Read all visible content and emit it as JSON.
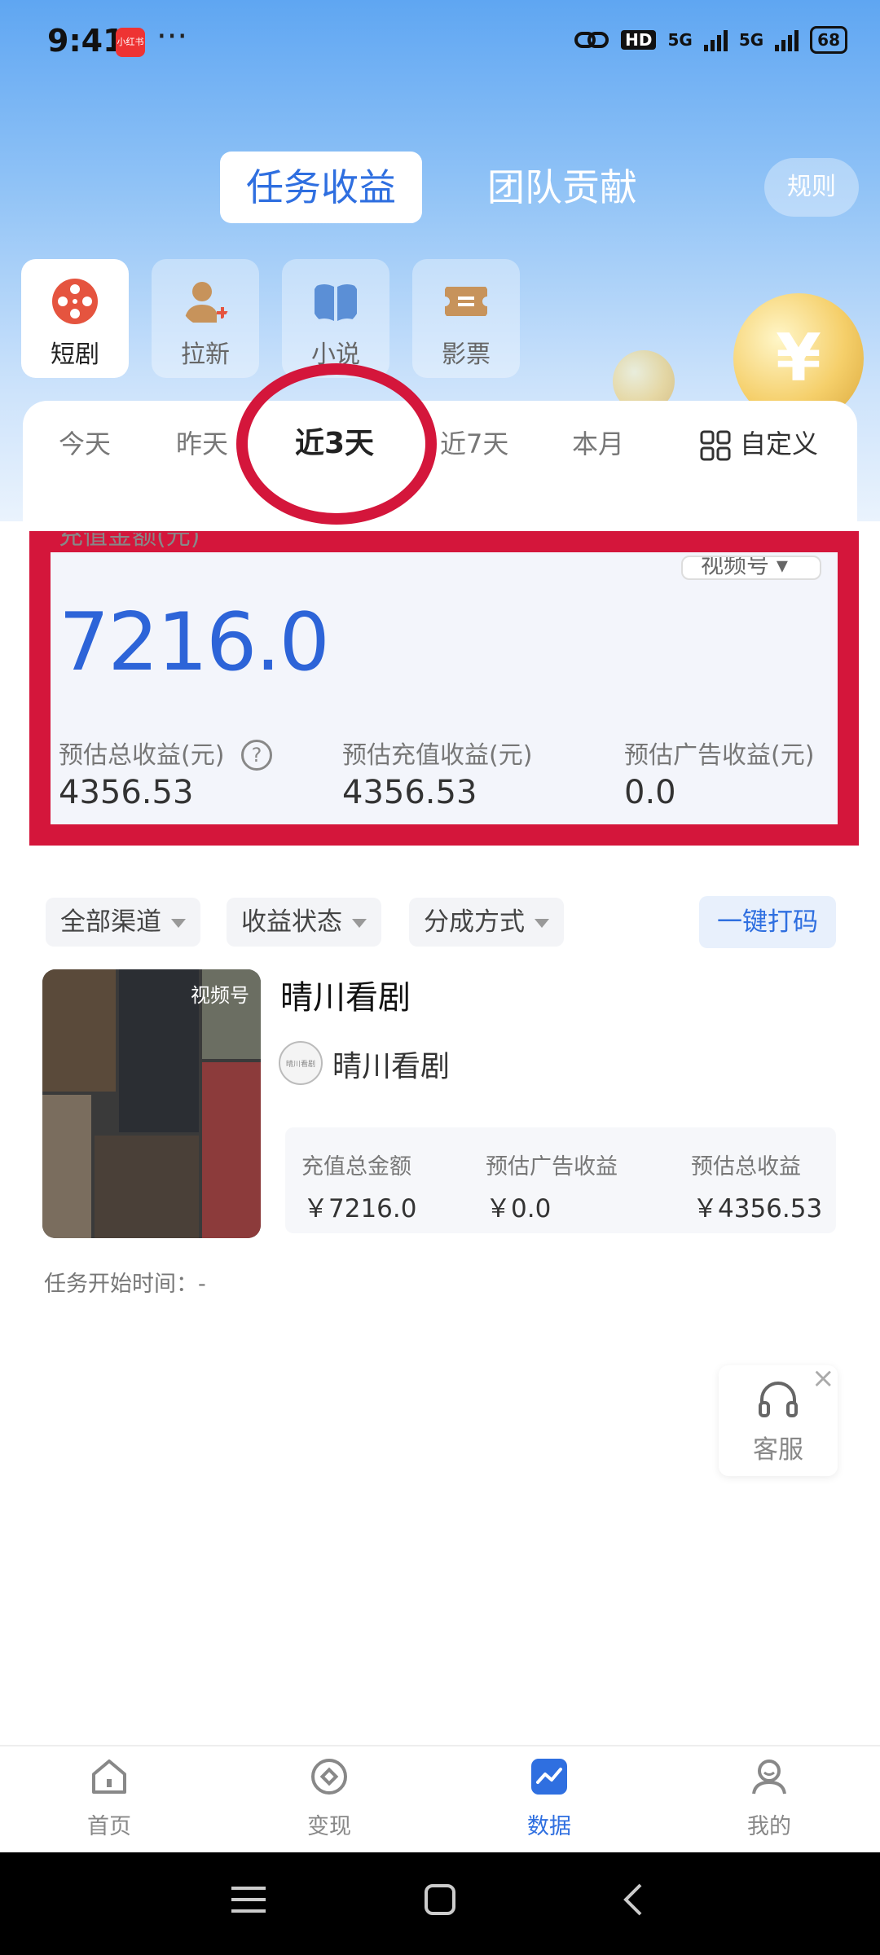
{
  "status": {
    "time": "9:41",
    "app_badge": "小红书",
    "dots": "···",
    "net1": "HD",
    "net2": "5G",
    "net3": "5G",
    "battery": "68"
  },
  "top_tabs": {
    "active": "任务收益",
    "inactive": "团队贡献",
    "rule": "规则"
  },
  "categories": [
    {
      "label": "短剧",
      "icon": "film-reel-icon",
      "color": "#e5543f"
    },
    {
      "label": "拉新",
      "icon": "add-user-icon",
      "color": "#c7935b"
    },
    {
      "label": "小说",
      "icon": "book-icon",
      "color": "#5b8fd6"
    },
    {
      "label": "影票",
      "icon": "ticket-icon",
      "color": "#c7935b"
    }
  ],
  "coin_symbol": "¥",
  "date_tabs": [
    "今天",
    "昨天",
    "近3天",
    "近7天",
    "本月",
    "自定义"
  ],
  "summary": {
    "label": "充值金额(元)",
    "amount": "7216.0",
    "channel_select": "视频号",
    "stats": [
      {
        "label": "预估总收益(元)",
        "value": "4356.53"
      },
      {
        "label": "预估充值收益(元)",
        "value": "4356.53"
      },
      {
        "label": "预估广告收益(元)",
        "value": "0.0"
      }
    ],
    "help": "?"
  },
  "filters": [
    "全部渠道",
    "收益状态",
    "分成方式"
  ],
  "action_button": "一键打码",
  "item": {
    "title": "晴川看剧",
    "tag": "视频号",
    "account": "晴川看剧",
    "avatar_text": "晴川看剧",
    "stats": [
      {
        "label": "充值总金额",
        "value": "￥7216.0"
      },
      {
        "label": "预估广告收益",
        "value": "￥0.0"
      },
      {
        "label": "预估总收益",
        "value": "￥4356.53"
      }
    ],
    "start_time": "任务开始时间：-"
  },
  "service": {
    "label": "客服",
    "close": "×"
  },
  "nav": [
    {
      "label": "首页",
      "icon": "home-icon",
      "active": false
    },
    {
      "label": "变现",
      "icon": "target-icon",
      "active": false
    },
    {
      "label": "数据",
      "icon": "chart-icon",
      "active": true
    },
    {
      "label": "我的",
      "icon": "user-icon",
      "active": false
    }
  ],
  "accent": "#2f6fe0",
  "annotation_color": "#d4163b"
}
